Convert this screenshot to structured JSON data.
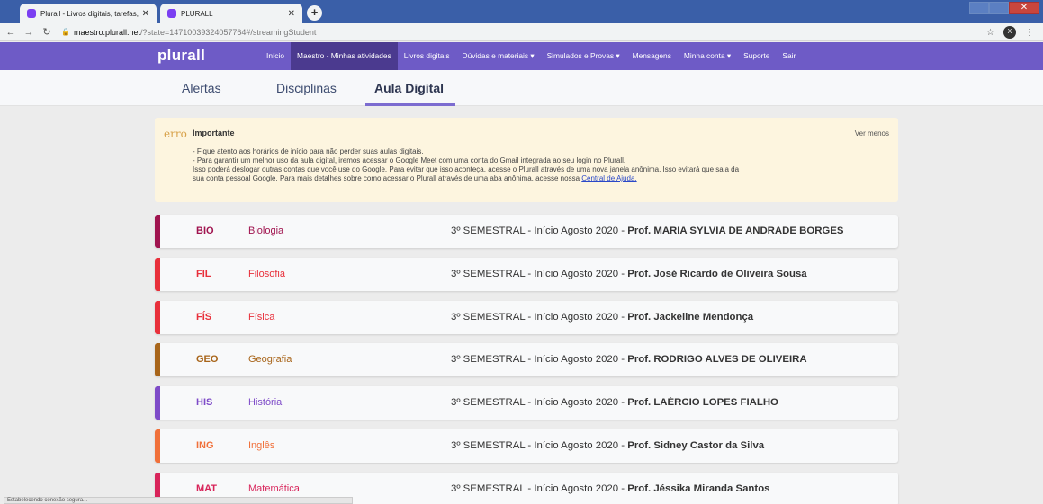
{
  "browser": {
    "tabs": [
      {
        "title": "Plurall - Livros digitais, tarefas, tu"
      },
      {
        "title": "PLURALL"
      }
    ],
    "url_host": "maestro.plurall.net",
    "url_path": "/?state=14710039324057764#/streamingStudent",
    "profile_initial": "X"
  },
  "nav": {
    "logo": "plurall",
    "items": [
      {
        "label": "Início"
      },
      {
        "label": "Maestro - Minhas atividades"
      },
      {
        "label": "Livros digitais"
      },
      {
        "label": "Dúvidas e materiais ▾"
      },
      {
        "label": "Simulados e Provas ▾"
      },
      {
        "label": "Mensagens"
      },
      {
        "label": "Minha conta ▾"
      },
      {
        "label": "Suporte"
      },
      {
        "label": "Sair"
      }
    ]
  },
  "subnav": {
    "tabs": [
      {
        "label": "Alertas"
      },
      {
        "label": "Disciplinas"
      },
      {
        "label": "Aula Digital"
      }
    ]
  },
  "notice": {
    "erro": "erro",
    "title": "Importante",
    "toggle": "Ver menos",
    "line1": "- Fique atento aos horários de início para não perder suas aulas digitais.",
    "line2": "- Para garantir um melhor uso da aula digital, iremos acessar o Google Meet com uma conta do Gmail integrada ao seu login no Plurall.",
    "line3": "Isso poderá deslogar outras contas que você use do Google. Para evitar que isso aconteça, acesse o Plurall através de uma nova janela anônima. Isso evitará que saia da",
    "line4": "sua conta pessoal Google. Para mais detalhes sobre como acessar o Plurall através de uma aba anônima, acesse nossa ",
    "link": "Central de Ajuda."
  },
  "subjects": [
    {
      "code": "BIO",
      "name": "Biologia",
      "semester": "3º SEMESTRAL - Início Agosto 2020 - ",
      "teacher": "Prof. MARIA SYLVIA DE ANDRADE BORGES",
      "color": "#a0144f"
    },
    {
      "code": "FIL",
      "name": "Filosofia",
      "semester": "3º SEMESTRAL - Início Agosto 2020 - ",
      "teacher": "Prof. José Ricardo de Oliveira Sousa",
      "color": "#e8303b"
    },
    {
      "code": "FÍS",
      "name": "Física",
      "semester": "3º SEMESTRAL - Início Agosto 2020 - ",
      "teacher": "Prof. Jackeline Mendonça",
      "color": "#e8303b"
    },
    {
      "code": "GEO",
      "name": "Geografia",
      "semester": "3º SEMESTRAL - Início Agosto 2020 - ",
      "teacher": "Prof. RODRIGO ALVES DE OLIVEIRA",
      "color": "#a8651a"
    },
    {
      "code": "HIS",
      "name": "História",
      "semester": "3º SEMESTRAL - Início Agosto 2020 - ",
      "teacher": "Prof. LAÉRCIO LOPES FIALHO",
      "color": "#7e4bc8"
    },
    {
      "code": "ING",
      "name": "Inglês",
      "semester": "3º SEMESTRAL - Início Agosto 2020 - ",
      "teacher": "Prof. Sidney Castor da Silva",
      "color": "#f0703a"
    },
    {
      "code": "MAT",
      "name": "Matemática",
      "semester": "3º SEMESTRAL - Início Agosto 2020 - ",
      "teacher": "Prof. Jéssika Miranda Santos",
      "color": "#d8245a"
    }
  ],
  "status_text": "Estabelecendo conexão segura..."
}
